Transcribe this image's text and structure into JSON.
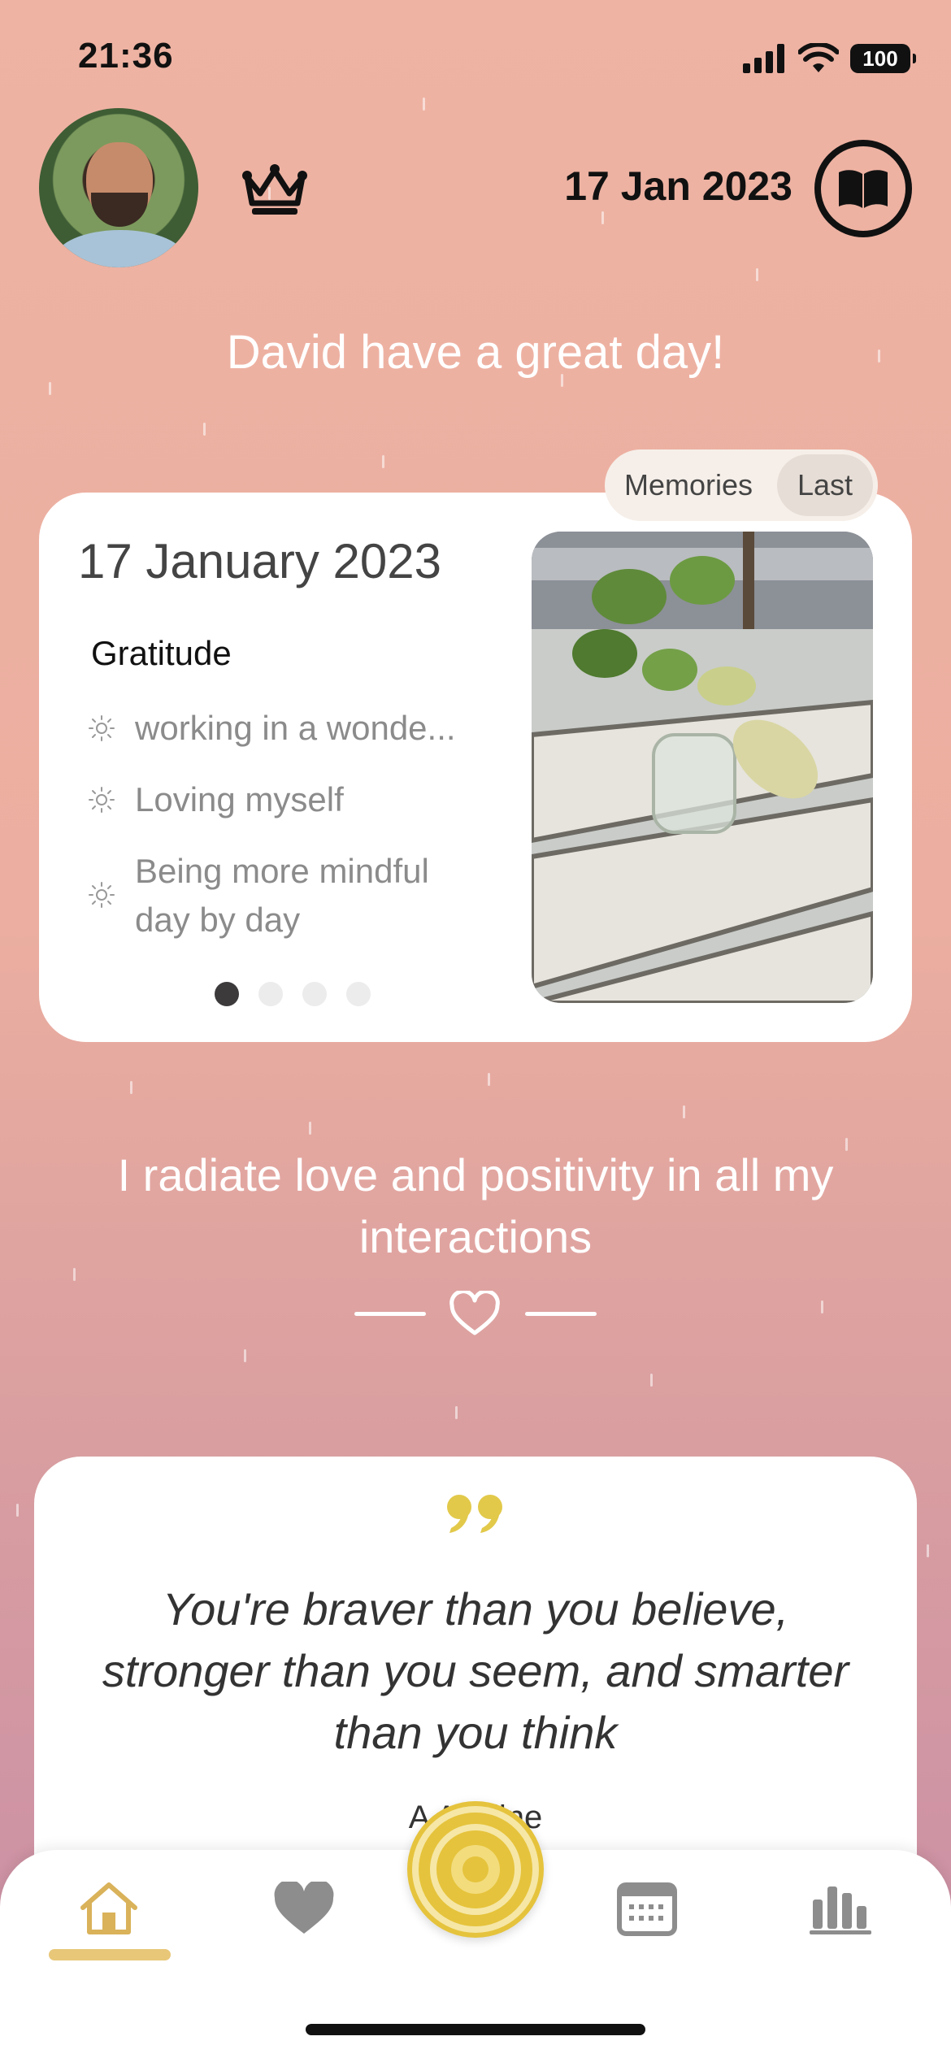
{
  "status_bar": {
    "time": "21:36",
    "battery": "100"
  },
  "header": {
    "date": "17 Jan 2023"
  },
  "greeting": "David have a great day!",
  "memories": {
    "toggle": [
      "Memories",
      "Last"
    ],
    "selected": "Last",
    "card": {
      "date": "17 January 2023",
      "category": "Gratitude",
      "items": [
        "working in a wonde...",
        "Loving myself",
        "Being more mindful day by day"
      ],
      "page_count": 4,
      "current_page": 1
    }
  },
  "affirmation": "I radiate love and positivity in all my interactions",
  "quote": {
    "text": "You're braver than you believe, stronger than you seem, and smarter than you think",
    "author": "A A Milne"
  },
  "tabs": [
    {
      "name": "home",
      "icon": "home-icon",
      "active": true
    },
    {
      "name": "favorites",
      "icon": "heart-icon",
      "active": false
    },
    {
      "name": "add",
      "icon": "target-icon",
      "active": false
    },
    {
      "name": "calendar",
      "icon": "calendar-icon",
      "active": false
    },
    {
      "name": "stats",
      "icon": "bar-chart-icon",
      "active": false
    }
  ],
  "colors": {
    "accent": "#e5c33c",
    "background_top": "#eeb3a3",
    "background_bottom": "#c98ea6"
  }
}
